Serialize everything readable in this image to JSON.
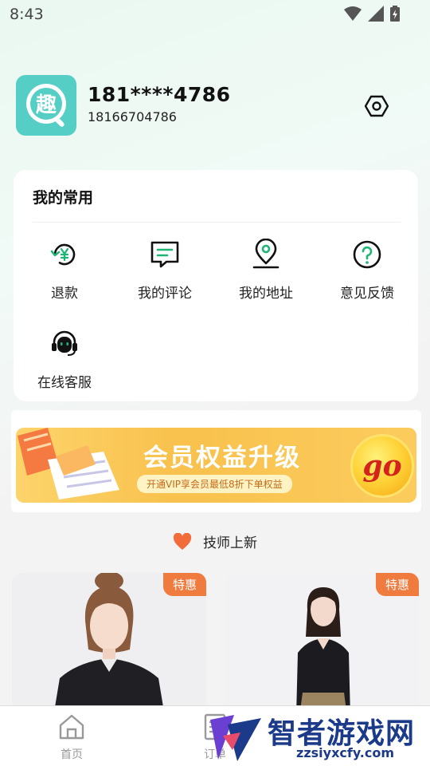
{
  "status_bar": {
    "time": "8:43"
  },
  "profile": {
    "display_name": "181****4786",
    "phone": "18166704786",
    "avatar_glyph": "趣"
  },
  "common": {
    "title": "我的常用",
    "items": [
      {
        "label": "退款",
        "icon": "refund-yen-icon"
      },
      {
        "label": "我的评论",
        "icon": "comment-icon"
      },
      {
        "label": "我的地址",
        "icon": "location-pin-icon"
      },
      {
        "label": "意见反馈",
        "icon": "question-icon"
      },
      {
        "label": "在线客服",
        "icon": "headset-icon"
      }
    ]
  },
  "banner": {
    "title": "会员权益升级",
    "subtitle": "开通VIP享会员最低8折下单权益",
    "go_label": "go"
  },
  "section": {
    "title": "技师上新"
  },
  "tech_cards": [
    {
      "tag": "特惠"
    },
    {
      "tag": "特惠"
    }
  ],
  "tabbar": {
    "tabs": [
      {
        "label": "首页"
      },
      {
        "label": "订单"
      }
    ]
  },
  "watermark": {
    "title": "智者游戏网",
    "url": "zzsiyxcfy.com"
  },
  "colors": {
    "accent_green": "#1fb574",
    "tag_orange": "#f07b3f",
    "banner_yellow": "#f9c14d",
    "heart_orange": "#f26b3a"
  }
}
